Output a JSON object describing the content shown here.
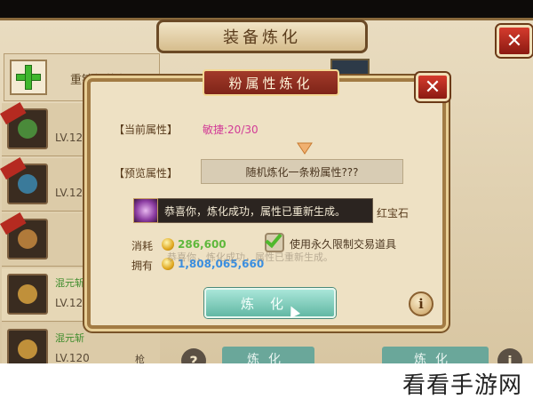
{
  "window": {
    "title": "装备炼化"
  },
  "sidebar": {
    "add_label": "重铸新装备",
    "items": [
      {
        "name": "",
        "level": "LV.12",
        "type": ""
      },
      {
        "name": "",
        "level": "LV.12",
        "type": ""
      },
      {
        "name": "",
        "level": "",
        "type": ""
      },
      {
        "name": "混元斩",
        "level": "LV.12",
        "type": ""
      },
      {
        "name": "混元斩",
        "level": "LV.120",
        "type": "枪"
      }
    ]
  },
  "background_buttons": {
    "refine_left": "炼化",
    "refine_right": "炼化"
  },
  "dialog": {
    "title": "粉属性炼化",
    "current_label": "【当前属性】",
    "current_value": "敏捷:20/30",
    "preview_label": "【预览属性】",
    "preview_value": "随机炼化一条粉属性???",
    "toast": "恭喜你，炼化成功，属性已重新生成。",
    "gem_text": "红宝石",
    "cost_label": "消耗",
    "cost_value": "286,600",
    "own_label": "拥有",
    "own_value": "1,808,065,660",
    "ghost_text": "恭喜你，炼化成功，属性已重新生成。",
    "use_bound_label": "使用永久限制交易道具",
    "use_bound_checked": true,
    "refine_button": "炼化",
    "info_icon_text": "i"
  },
  "watermark": {
    "text": "看看手游网"
  },
  "colors": {
    "accent_pink": "#d23b97",
    "cost_green": "#5fb83c",
    "own_blue": "#3a8ee0",
    "title_red": "#7e2418",
    "button_teal": "#62b8a4"
  }
}
